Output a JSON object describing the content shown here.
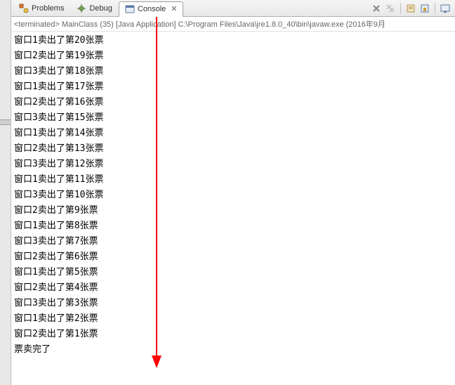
{
  "tabs": [
    {
      "label": "Problems",
      "icon": "problems"
    },
    {
      "label": "Debug",
      "icon": "debug"
    },
    {
      "label": "Console",
      "icon": "console",
      "active": true
    }
  ],
  "close_x": "✕",
  "status": "<terminated> MainClass (35) [Java Application] C:\\Program Files\\Java\\jre1.8.0_40\\bin\\javaw.exe (2016年9月",
  "output": [
    "窗口1卖出了第20张票",
    "窗口2卖出了第19张票",
    "窗口3卖出了第18张票",
    "窗口1卖出了第17张票",
    "窗口2卖出了第16张票",
    "窗口3卖出了第15张票",
    "窗口1卖出了第14张票",
    "窗口2卖出了第13张票",
    "窗口3卖出了第12张票",
    "窗口1卖出了第11张票",
    "窗口3卖出了第10张票",
    "窗口2卖出了第9张票",
    "窗口1卖出了第8张票",
    "窗口3卖出了第7张票",
    "窗口2卖出了第6张票",
    "窗口1卖出了第5张票",
    "窗口2卖出了第4张票",
    "窗口3卖出了第3张票",
    "窗口1卖出了第2张票",
    "窗口2卖出了第1张票",
    "票卖完了"
  ]
}
